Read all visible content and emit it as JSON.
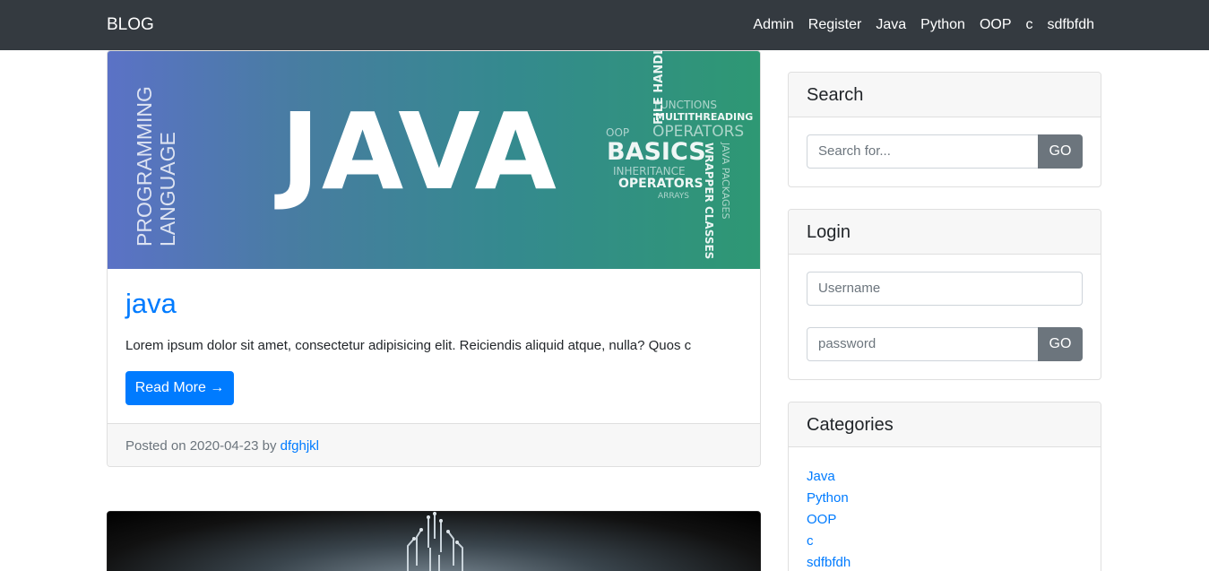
{
  "nav": {
    "brand": "BLOG",
    "links": [
      "Admin",
      "Register",
      "Java",
      "Python",
      "OOP",
      "c",
      "sdfbfdh"
    ]
  },
  "post": {
    "image": {
      "main_word": "JAVA",
      "side_lines": [
        "PROGRAMMING",
        "LANGUAGE"
      ],
      "tags": [
        "FUNCTIONS",
        "MULTITHREADING",
        "OOP",
        "OPERATORS",
        "BASICS",
        "INHERITANCE",
        "OPERATORS",
        "ARRAYS",
        "FILE HANDLING",
        "WRAPPER CLASSES",
        "JAVA PACKAGES"
      ]
    },
    "title": "java",
    "excerpt": "Lorem ipsum dolor sit amet, consectetur adipisicing elit. Reiciendis aliquid atque, nulla? Quos c",
    "read_more": "Read More →",
    "posted_prefix": "Posted on 2020-04-23 by ",
    "author": "dfghjkl"
  },
  "sidebar": {
    "search": {
      "title": "Search",
      "placeholder": "Search for...",
      "button": "GO"
    },
    "login": {
      "title": "Login",
      "username_placeholder": "Username",
      "password_placeholder": "password",
      "button": "GO"
    },
    "categories": {
      "title": "Categories",
      "items": [
        "Java",
        "Python",
        "OOP",
        "c",
        "sdfbfdh"
      ]
    }
  },
  "colors": {
    "navbar": "#343a40",
    "primary": "#007bff",
    "secondary": "#6c757d"
  }
}
